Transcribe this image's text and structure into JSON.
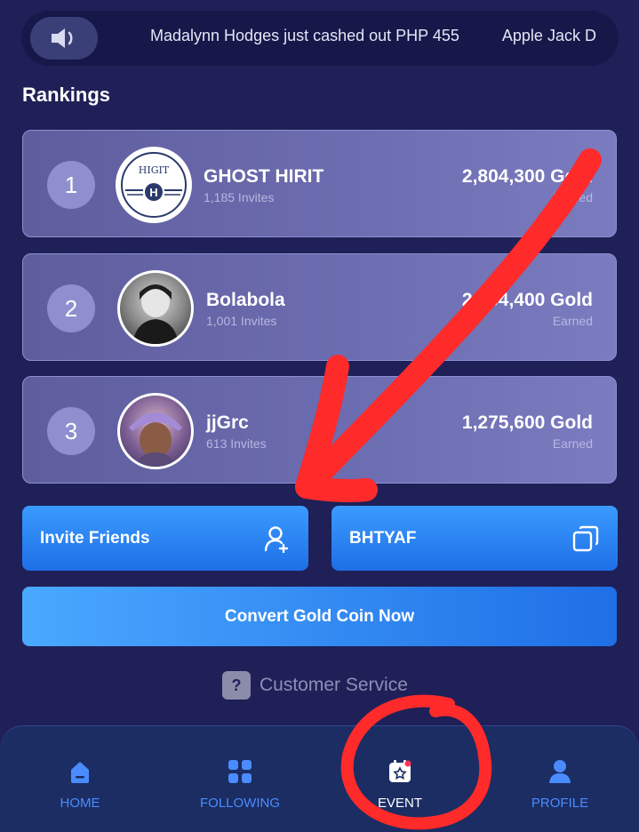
{
  "ticker": {
    "messages": [
      "Madalynn Hodges just cashed out PHP 455",
      "Apple Jack D"
    ]
  },
  "rankings": {
    "title": "Rankings",
    "items": [
      {
        "rank": "1",
        "name": "GHOST HIRIT",
        "invites": "1,185 Invites",
        "gold": "2,804,300 Gold",
        "earned": "Earned"
      },
      {
        "rank": "2",
        "name": "Bolabola",
        "invites": "1,001 Invites",
        "gold": "2,554,400 Gold",
        "earned": "Earned"
      },
      {
        "rank": "3",
        "name": "jjGrc",
        "invites": "613 Invites",
        "gold": "1,275,600 Gold",
        "earned": "Earned"
      }
    ]
  },
  "actions": {
    "invite_label": "Invite Friends",
    "code_label": "BHTYAF",
    "convert_label": "Convert Gold Coin Now",
    "customer_service": "Customer Service",
    "cs_icon_glyph": "?"
  },
  "avatar1_text": {
    "top": "HIGIT",
    "letter": "H"
  },
  "nav": {
    "items": [
      {
        "label": "HOME",
        "icon": "home-icon"
      },
      {
        "label": "FOLLOWING",
        "icon": "grid-icon"
      },
      {
        "label": "EVENT",
        "icon": "event-icon"
      },
      {
        "label": "PROFILE",
        "icon": "profile-icon"
      }
    ],
    "active": "EVENT"
  },
  "colors": {
    "background": "#1f2057",
    "card": "#6c6cb0",
    "accent_blue": "#1f6fe6",
    "nav_blue": "#4a8cff",
    "annotation_red": "#ff2a2a"
  }
}
